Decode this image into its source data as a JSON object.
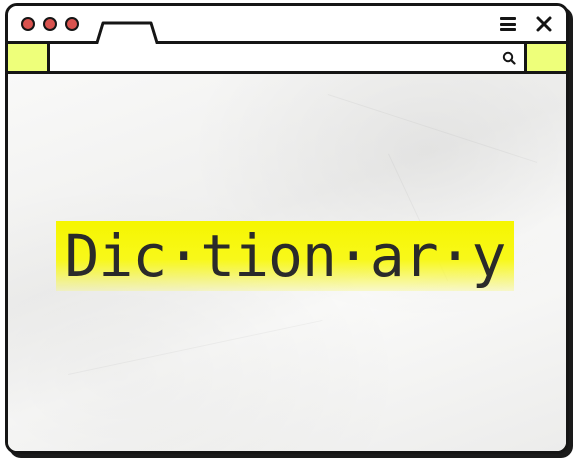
{
  "window": {
    "controls": [
      "red-dot",
      "red-dot",
      "red-dot"
    ],
    "menu_icon": "hamburger-menu-icon",
    "close_icon": "close-icon"
  },
  "address_bar": {
    "value": "",
    "placeholder": "",
    "search_icon": "search-icon"
  },
  "content": {
    "word": "Dic·tion·ar·y"
  },
  "colors": {
    "highlight": "#f6f600",
    "accent_block": "#eeff7a",
    "dot": "#d9534f",
    "border": "#151515"
  }
}
